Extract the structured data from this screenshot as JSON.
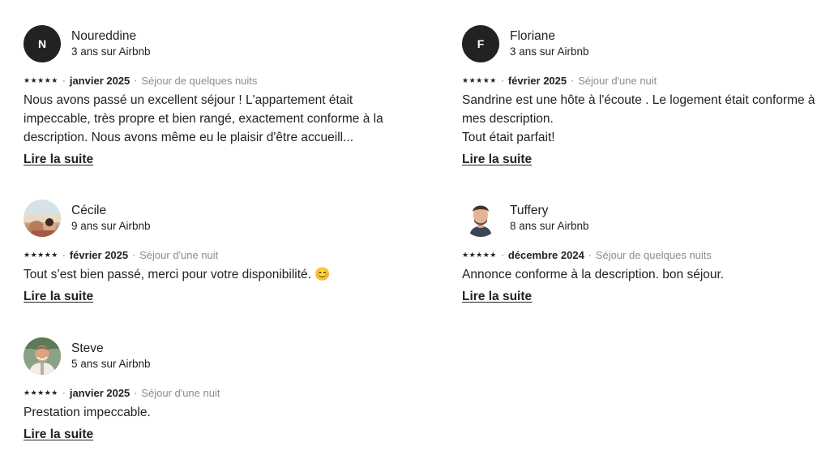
{
  "reviews": [
    {
      "avatar_initial": "N",
      "avatar_icon": "initial",
      "name": "Noureddine",
      "tenure": "3 ans sur Airbnb",
      "stars": "★★★★★",
      "date": "janvier 2025",
      "stay": "Séjour de quelques nuits",
      "text": "Nous avons passé un excellent séjour ! L'appartement était impeccable, très propre et bien rangé, exactement conforme à la description. Nous avons même eu le plaisir d'être accueill...",
      "read_more": "Lire la suite"
    },
    {
      "avatar_initial": "F",
      "avatar_icon": "initial",
      "name": "Floriane",
      "tenure": "3 ans sur Airbnb",
      "stars": "★★★★★",
      "date": "février 2025",
      "stay": "Séjour d'une nuit",
      "text": "Sandrine est une hôte à l'écoute . Le logement était conforme à mes description.\nTout était parfait!",
      "read_more": "Lire la suite"
    },
    {
      "avatar_icon": "photo",
      "name": "Cécile",
      "tenure": "9 ans sur Airbnb",
      "stars": "★★★★★",
      "date": "février 2025",
      "stay": "Séjour d'une nuit",
      "text": "Tout s’est bien passé, merci pour votre disponibilité. 😊",
      "read_more": "Lire la suite"
    },
    {
      "avatar_icon": "photo",
      "name": "Tuffery",
      "tenure": "8 ans sur Airbnb",
      "stars": "★★★★★",
      "date": "décembre 2024",
      "stay": "Séjour de quelques nuits",
      "text": "Annonce conforme à la description. bon séjour.",
      "read_more": "Lire la suite"
    },
    {
      "avatar_icon": "photo",
      "name": "Steve",
      "tenure": "5 ans sur Airbnb",
      "stars": "★★★★★",
      "date": "janvier 2025",
      "stay": "Séjour d'une nuit",
      "text": "Prestation impeccable.",
      "read_more": "Lire la suite"
    }
  ],
  "separator": "·",
  "colors": {
    "text": "#222222",
    "muted": "#8c8c8c",
    "avatar_bg": "#222222"
  }
}
